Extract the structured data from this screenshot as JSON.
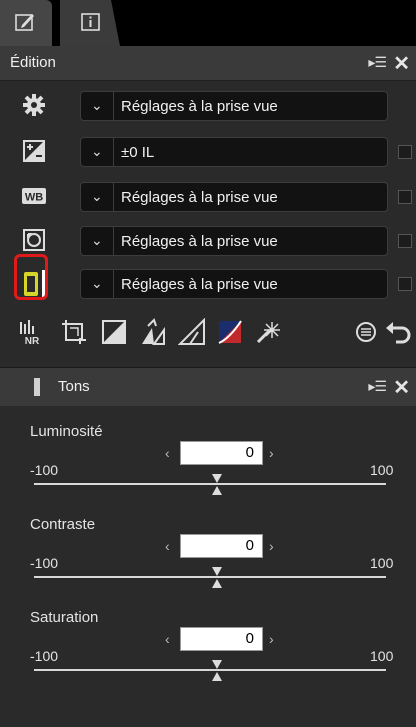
{
  "tabs": [
    {
      "icon": "edit-pencil-icon"
    },
    {
      "icon": "info-icon"
    }
  ],
  "edition": {
    "title": "Édition",
    "rows": [
      {
        "icon": "gear-icon",
        "value": "Réglages à la prise vue",
        "has_checkbox": false
      },
      {
        "icon": "exposure-compensation-icon",
        "value": "±0 IL",
        "has_checkbox": true
      },
      {
        "icon": "white-balance-icon",
        "value": "Réglages à la prise vue",
        "has_checkbox": true
      },
      {
        "icon": "picture-control-icon",
        "value": "Réglages à la prise vue",
        "has_checkbox": true
      },
      {
        "icon": "tone-adjust-icon",
        "value": "Réglages à la prise vue",
        "has_checkbox": true
      }
    ],
    "toolbar": [
      "noise-reduction-icon",
      "crop-icon",
      "curves-icon",
      "levels-icon",
      "straighten-icon",
      "color-balance-icon",
      "retouch-brush-icon"
    ],
    "toolbar_right": [
      "history-icon",
      "undo-icon"
    ]
  },
  "tons": {
    "title": "Tons",
    "sliders": [
      {
        "label": "Luminosité",
        "min": "-100",
        "max": "100",
        "value": "0"
      },
      {
        "label": "Contraste",
        "min": "-100",
        "max": "100",
        "value": "0"
      },
      {
        "label": "Saturation",
        "min": "-100",
        "max": "100",
        "value": "0"
      }
    ]
  },
  "colors": {
    "highlight": "#e01a1a",
    "background": "#2a2a2a"
  }
}
